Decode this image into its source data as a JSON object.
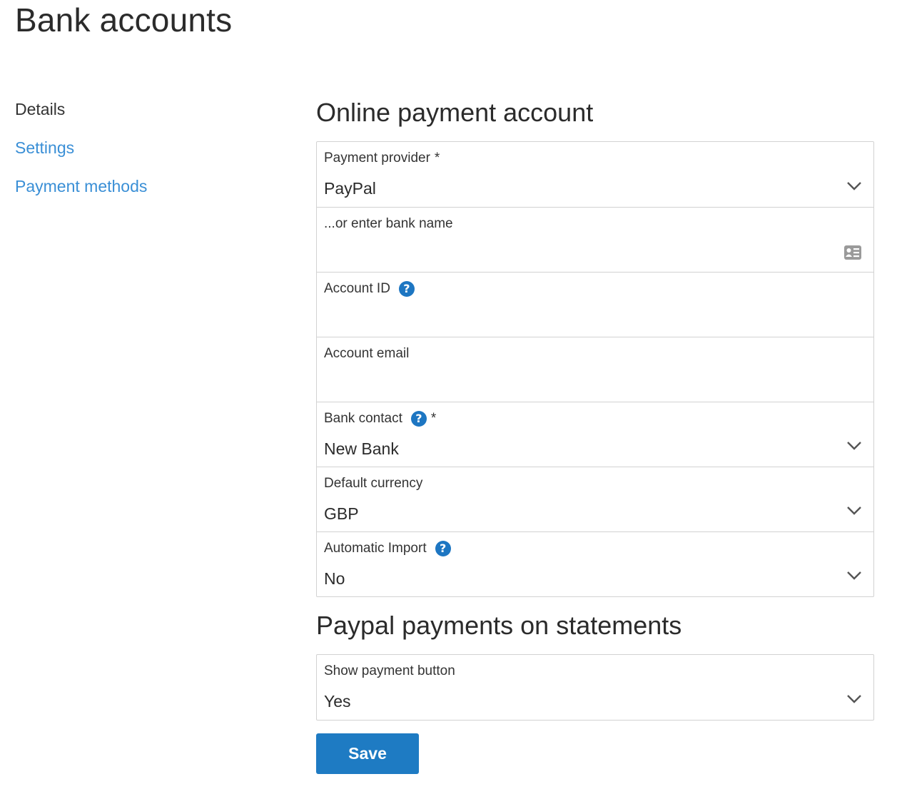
{
  "page": {
    "title": "Bank accounts"
  },
  "sidebar": {
    "items": [
      {
        "label": "Details",
        "active": true
      },
      {
        "label": "Settings",
        "active": false
      },
      {
        "label": "Payment methods",
        "active": false
      }
    ]
  },
  "sections": {
    "online_payment": {
      "title": "Online payment account",
      "fields": {
        "payment_provider": {
          "label": "Payment provider",
          "required": "*",
          "value": "PayPal",
          "icon": "chevron-down-icon"
        },
        "bank_name": {
          "label": "...or enter bank name",
          "value": "",
          "icon": "contact-card-icon"
        },
        "account_id": {
          "label": "Account ID",
          "help": "?",
          "value": ""
        },
        "account_email": {
          "label": "Account email",
          "value": ""
        },
        "bank_contact": {
          "label": "Bank contact",
          "help": "?",
          "required": "*",
          "value": "New Bank",
          "icon": "chevron-down-icon"
        },
        "default_currency": {
          "label": "Default currency",
          "value": "GBP",
          "icon": "chevron-down-icon"
        },
        "automatic_import": {
          "label": "Automatic Import",
          "help": "?",
          "value": "No",
          "icon": "chevron-down-icon"
        }
      }
    },
    "paypal_statements": {
      "title": "Paypal payments on statements",
      "fields": {
        "show_payment_button": {
          "label": "Show payment button",
          "value": "Yes",
          "icon": "chevron-down-icon"
        }
      }
    }
  },
  "actions": {
    "save_label": "Save"
  },
  "colors": {
    "link": "#3a8fd6",
    "primary": "#1e7bc3",
    "help_icon": "#1d76c2",
    "border": "#d2d2d2"
  }
}
